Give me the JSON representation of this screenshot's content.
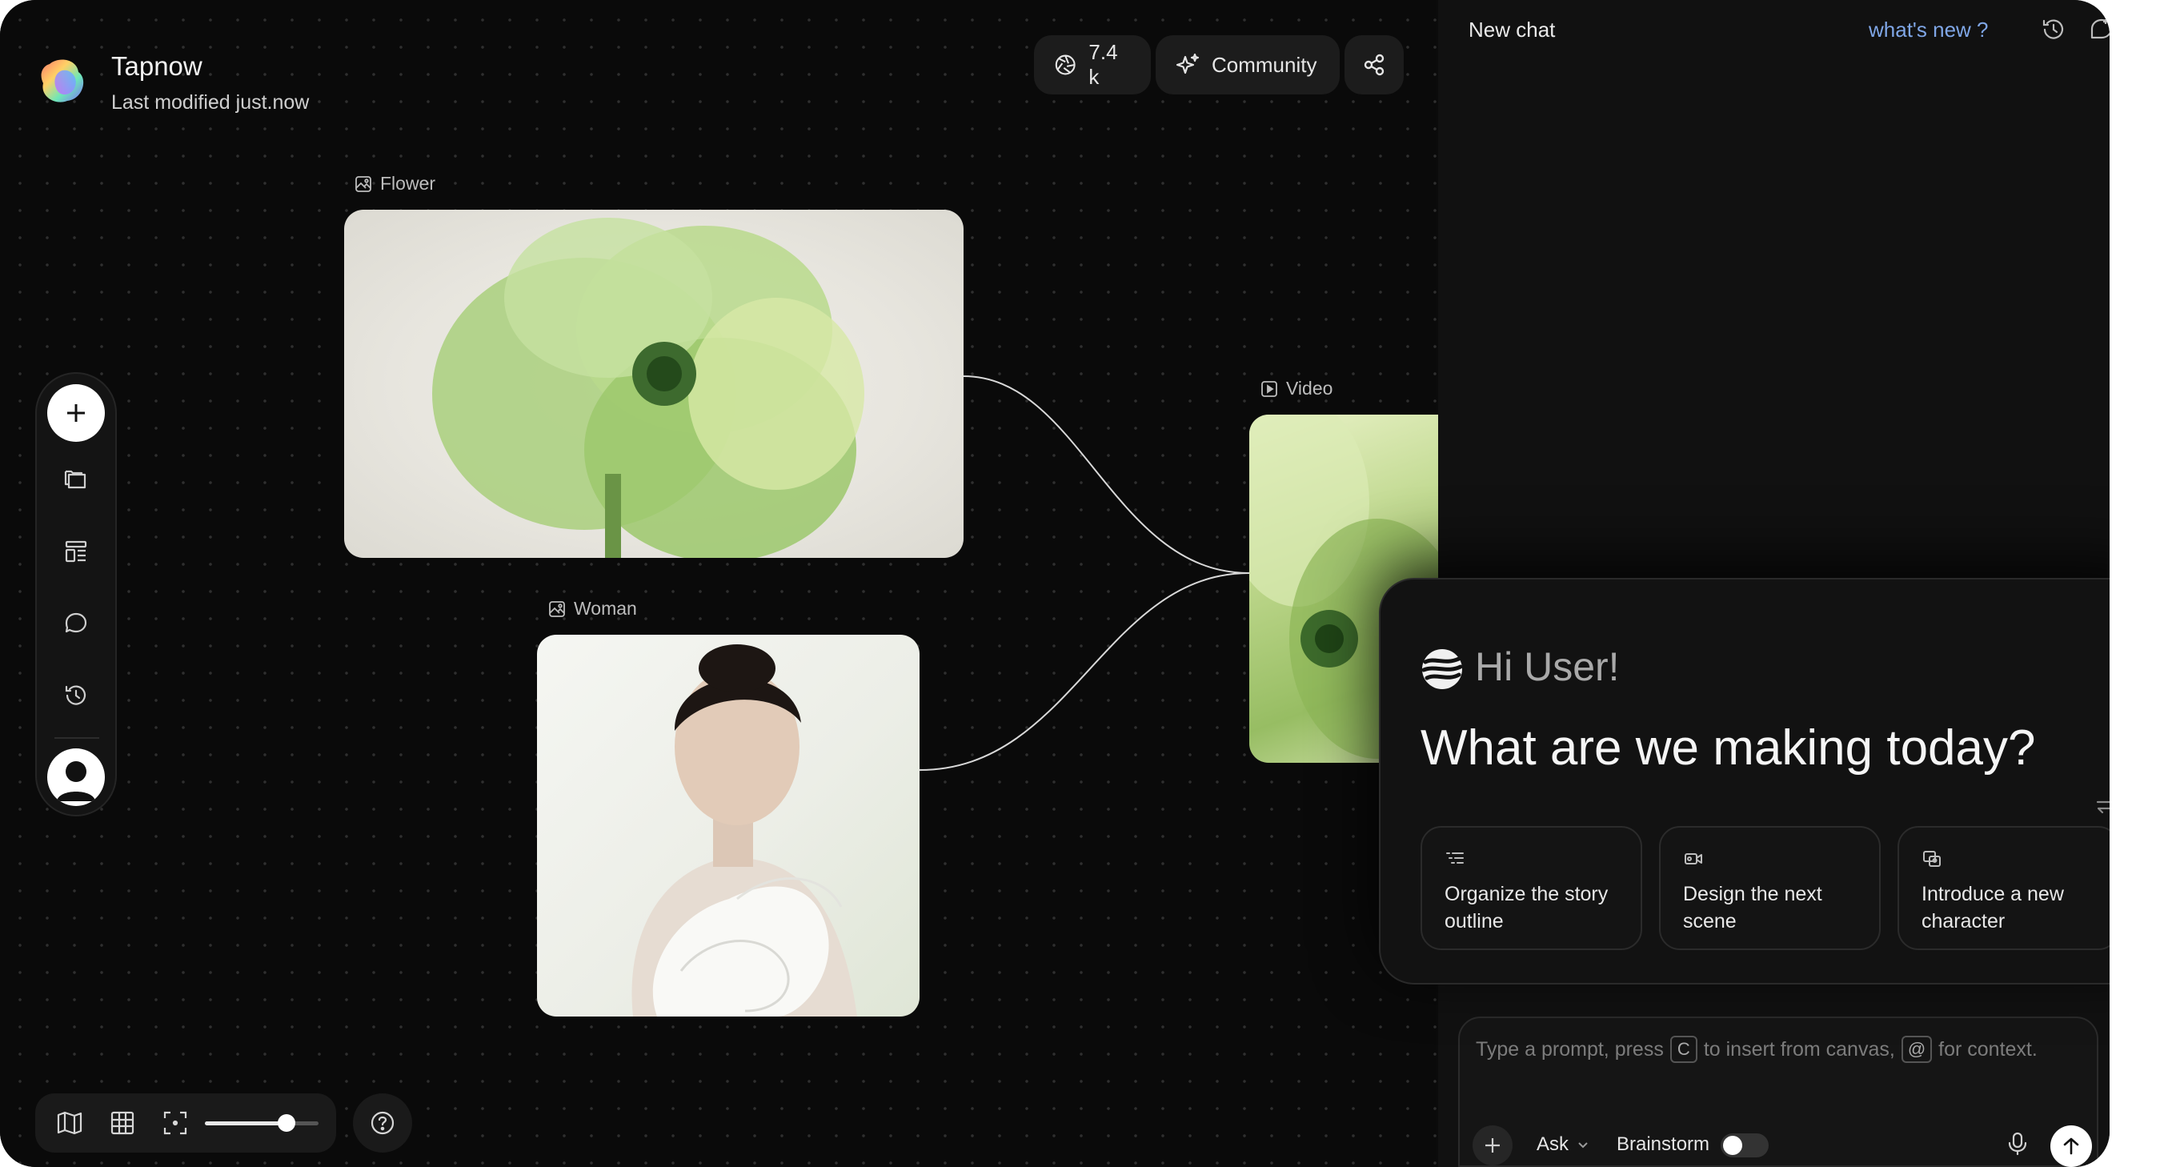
{
  "header": {
    "app_title": "Tapnow",
    "subtitle": "Last modified just.now",
    "stars_count": "7.4 k",
    "community_label": "Community"
  },
  "nodes": {
    "flower_label": "Flower",
    "woman_label": "Woman",
    "video_label": "Video"
  },
  "chat": {
    "title": "New chat",
    "whats_new": "what's new ?",
    "greeting": "Hi User!",
    "question": "What are we making today?",
    "suggestions": [
      {
        "label": "Organize the story outline",
        "icon": "list-outline-icon"
      },
      {
        "label": "Design the next scene",
        "icon": "video-camera-icon"
      },
      {
        "label": "Introduce a new character",
        "icon": "character-icon"
      }
    ],
    "input": {
      "prompt_part1": "Type a prompt, press",
      "key_canvas": "C",
      "prompt_part2": "to insert from canvas,",
      "key_context": "@",
      "prompt_part3": "for context.",
      "ask_label": "Ask",
      "brainstorm_label": "Brainstorm",
      "brainstorm_enabled": false
    }
  },
  "canvas": {
    "zoom_level": 0.72
  },
  "colors": {
    "accent_link": "#7fa6e6",
    "background": "#0b0b0b",
    "panel": "#111111"
  }
}
